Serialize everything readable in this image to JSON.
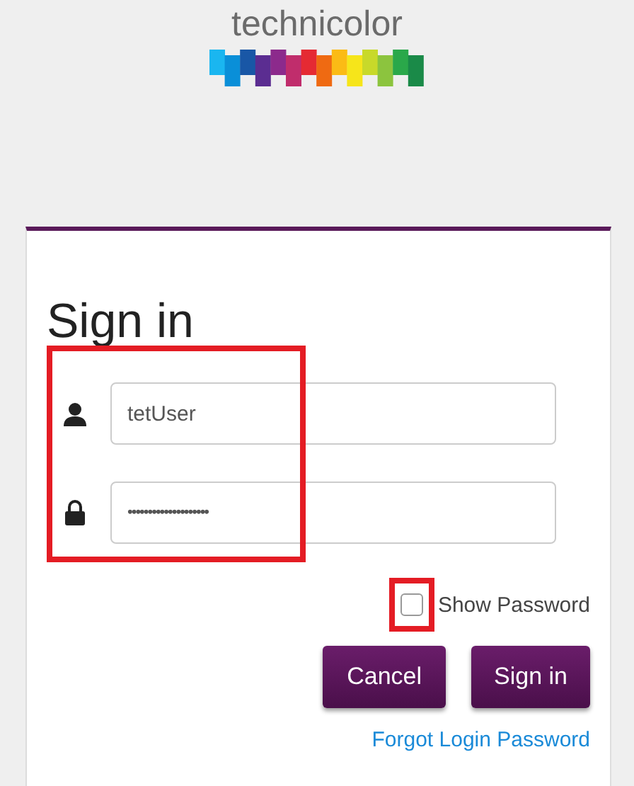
{
  "logo": {
    "text": "technicolor"
  },
  "form": {
    "title": "Sign in",
    "username": {
      "value": "tetUser"
    },
    "password": {
      "value": "••••••••••••••••••••"
    },
    "fields_highlighted": true,
    "show_password": {
      "label": "Show Password",
      "checked": false,
      "highlighted": true
    },
    "buttons": [
      "Cancel",
      "Sign in"
    ],
    "link": "Forgot Login Password"
  }
}
